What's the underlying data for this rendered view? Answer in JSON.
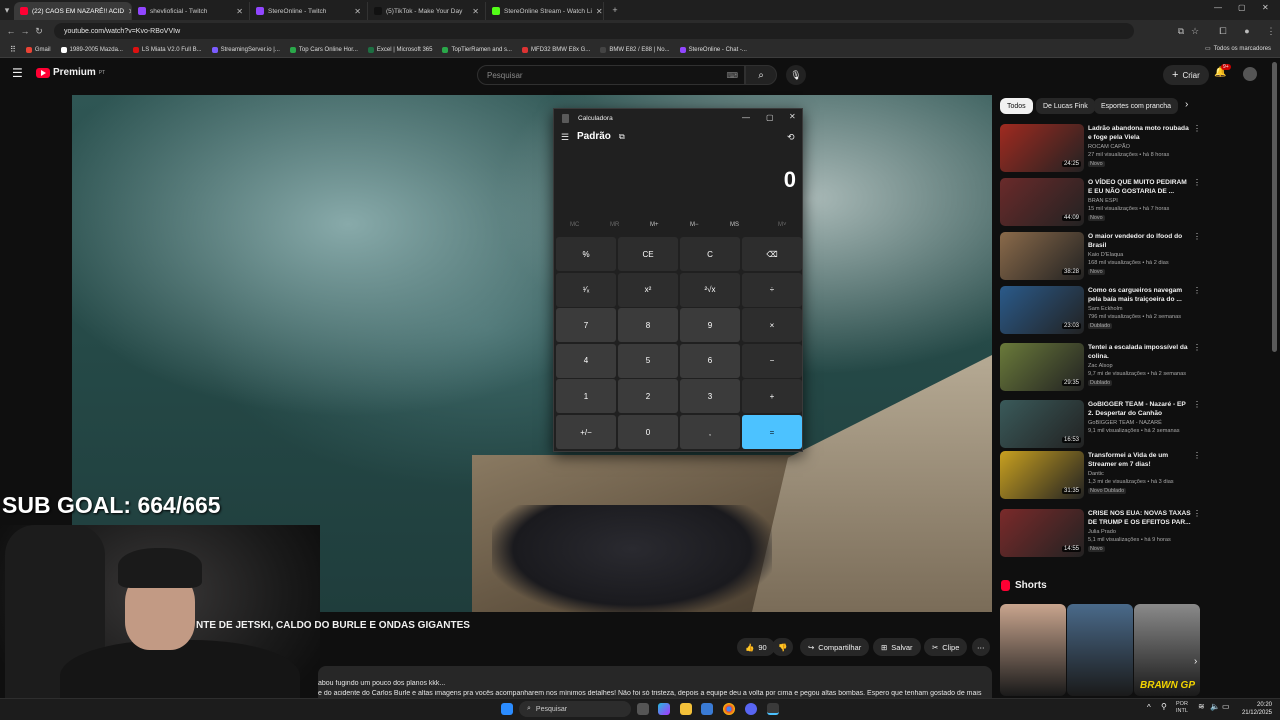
{
  "browser": {
    "tabs": [
      {
        "label": "(22) CAOS EM NAZARÉ!! ACID",
        "color": "#ff0033",
        "active": true
      },
      {
        "label": "shevlioficial - Twitch",
        "color": "#9146ff",
        "active": false
      },
      {
        "label": "StereOnline - Twitch",
        "color": "#9146ff",
        "active": false
      },
      {
        "label": "(5)TikTok - Make Your Day",
        "color": "#111111",
        "active": false
      },
      {
        "label": "StereOnline Stream - Watch Li",
        "color": "#53fc18",
        "active": false
      }
    ],
    "url": "youtube.com/watch?v=Kvo-RBoVVIw",
    "bookmarks": [
      {
        "label": "Gmail",
        "color": "#ea4335"
      },
      {
        "label": "1989-2005 Mazda...",
        "color": "#ffffff"
      },
      {
        "label": "LS Miata V2.0 Full B...",
        "color": "#d11"
      },
      {
        "label": "StreamingServer.io |...",
        "color": "#7b5cff"
      },
      {
        "label": "Top Cars Online Hor...",
        "color": "#2aa84a"
      },
      {
        "label": "Excel | Microsoft 365",
        "color": "#1d6f42"
      },
      {
        "label": "TopTierRamen and s...",
        "color": "#2aa84a"
      },
      {
        "label": "MFD32 BMW E8x G...",
        "color": "#d33"
      },
      {
        "label": "BMW E82 / E88 | No...",
        "color": "#444"
      },
      {
        "label": "StereOnline - Chat -...",
        "color": "#9146ff"
      }
    ],
    "all_bookmarks": "Todos os marcadores"
  },
  "youtube": {
    "logo": "Premium",
    "logo_sup": "PT",
    "search_placeholder": "Pesquisar",
    "create_label": "Criar",
    "notif_count": "9+",
    "video_title": "NTE DE JETSKI, CALDO DO BURLE E ONDAS GIGANTES",
    "actions": {
      "likes": "90",
      "share": "Compartilhar",
      "save": "Salvar",
      "clip": "Clipe"
    },
    "desc_line1": "abou fugindo um pouco dos planos kkk...",
    "desc_line2": "e do acidente do Carlos Burle e altas imagens pra vocês acompanharem nos mínimos detalhes! Não foi só tristeza, depois a equipe deu a volta por cima e pegou altas bombas. Espero que tenham gostado de mais",
    "chips": [
      "Todos",
      "De Lucas Fink",
      "Esportes com prancha"
    ],
    "recommendations": [
      {
        "title": "Ladrão abandona moto roubada e foge pela Viela",
        "channel": "ROCAM CAPÃO",
        "meta": "27 mil visualizações • há 8 horas",
        "badge": "Novo",
        "duration": "24:25",
        "thumb": "#a02a20"
      },
      {
        "title": "O VÍDEO QUE MUITO PEDIRAM E EU NÃO GOSTARIA DE ...",
        "channel": "BRAN ESPI",
        "meta": "15 mil visualizações • há 7 horas",
        "badge": "Novo",
        "duration": "44:09",
        "thumb": "#6a2a2a"
      },
      {
        "title": "O maior vendedor do Ifood do Brasil",
        "channel": "Kaio D'Elaqua",
        "meta": "168 mil visualizações • há 2 dias",
        "badge": "Novo",
        "duration": "38:28",
        "thumb": "#8a6a4a"
      },
      {
        "title": "Como os cargueiros navegam pela baía mais traiçoeira do ...",
        "channel": "Sam Eckholm",
        "meta": "796 mil visualizações • há 2 semanas",
        "badge": "Dublado",
        "duration": "23:03",
        "thumb": "#2a5a8a"
      },
      {
        "title": "Tentei a escalada impossível da colina.",
        "channel": "Zac Alsop",
        "meta": "9,7 mi de visualizações • há 2 semanas",
        "badge": "Dublado",
        "duration": "29:35",
        "thumb": "#6a7a3a"
      },
      {
        "title": "GoBIGGER TEAM - Nazaré - EP 2. Despertar do Canhão",
        "channel": "GoBIGGER TEAM - NAZARÉ",
        "meta": "9,1 mil visualizações • há 2 semanas",
        "badge": "",
        "duration": "16:53",
        "thumb": "#3a5a5a"
      },
      {
        "title": "Transformei a Vida de um Streamer em 7 dias!",
        "channel": "Dantic",
        "meta": "1,3 mi de visualizações • há 3 dias",
        "badge": "Novo  Dublado",
        "duration": "31:35",
        "thumb": "#c8a020"
      },
      {
        "title": "CRISE NOS EUA: NOVAS TAXAS DE TRUMP E OS EFEITOS PAR...",
        "channel": "Julia Prado",
        "meta": "5,1 mil visualizações • há 9 horas",
        "badge": "Novo",
        "duration": "14:55",
        "thumb": "#7a2a2a"
      }
    ],
    "shorts_title": "Shorts",
    "shorts": [
      {
        "color": "#c9a58e"
      },
      {
        "color": "#4a6a8a"
      },
      {
        "color": "#8a8a8a"
      }
    ],
    "shorts_caption": "BRAWN GP"
  },
  "overlay": {
    "sub_goal": "SUB GOAL: 664/665"
  },
  "calculator": {
    "title": "Calculadora",
    "mode": "Padrão",
    "display": "0",
    "memory": [
      "MC",
      "MR",
      "M+",
      "M−",
      "MS",
      "M˅"
    ],
    "keys": [
      [
        "%",
        "CE",
        "C",
        "⌫"
      ],
      [
        "¹⁄ₓ",
        "x²",
        "²√x",
        "÷"
      ],
      [
        "7",
        "8",
        "9",
        "×"
      ],
      [
        "4",
        "5",
        "6",
        "−"
      ],
      [
        "1",
        "2",
        "3",
        "+"
      ],
      [
        "+/−",
        "0",
        ",",
        "="
      ]
    ]
  },
  "taskbar": {
    "search": "Pesquisar",
    "lang_top": "POR",
    "lang_bottom": "INTL",
    "time": "20:20",
    "date": "21/12/2025"
  }
}
